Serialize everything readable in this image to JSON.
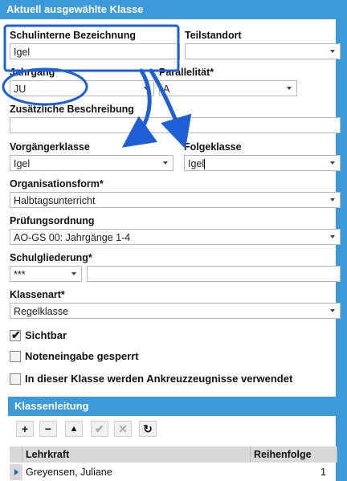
{
  "header": {
    "title": "Aktuell ausgewählte Klasse"
  },
  "fields": {
    "schulinterne_label": "Schulinterne Bezeichnung",
    "schulinterne_value": "Igel",
    "teilstandort_label": "Teilstandort",
    "teilstandort_value": "",
    "jahrgang_label": "Jahrgang*",
    "jahrgang_value": "JU",
    "parallelitaet_label": "Parallelität*",
    "parallelitaet_value": "A",
    "zusatz_label": "Zusätzliche Beschreibung",
    "zusatz_value": "",
    "vorgaenger_label": "Vorgängerklasse",
    "vorgaenger_value": "Igel",
    "folge_label": "Folgeklasse",
    "folge_value": "Igel",
    "orgform_label": "Organisationsform*",
    "orgform_value": "Halbtagsunterricht",
    "pruefung_label": "Prüfungsordnung",
    "pruefung_value": "AO-GS 00: Jahrgänge 1-4",
    "schulgliederung_label": "Schulgliederung*",
    "schulgliederung_value": "***",
    "schulgliederung_extra": "",
    "klassenart_label": "Klassenart*",
    "klassenart_value": "Regelklasse"
  },
  "checkboxes": [
    {
      "label": "Sichtbar",
      "checked": true
    },
    {
      "label": "Noteneingabe gesperrt",
      "checked": false
    },
    {
      "label": "In dieser Klasse werden Ankreuzzeugnisse verwendet",
      "checked": false
    }
  ],
  "klassenleitung": {
    "title": "Klassenleitung",
    "toolbar": {
      "add": "+",
      "remove": "−",
      "up": "▲",
      "confirm": "✔",
      "cancel": "✕",
      "refresh": "↻"
    },
    "columns": {
      "lehrkraft": "Lehrkraft",
      "reihenfolge": "Reihenfolge"
    },
    "rows": [
      {
        "lehrkraft": "Greyensen, Juliane",
        "reihenfolge": "1"
      }
    ]
  },
  "colors": {
    "accent": "#3d9ad9",
    "highlight": "#1e5fd6"
  }
}
